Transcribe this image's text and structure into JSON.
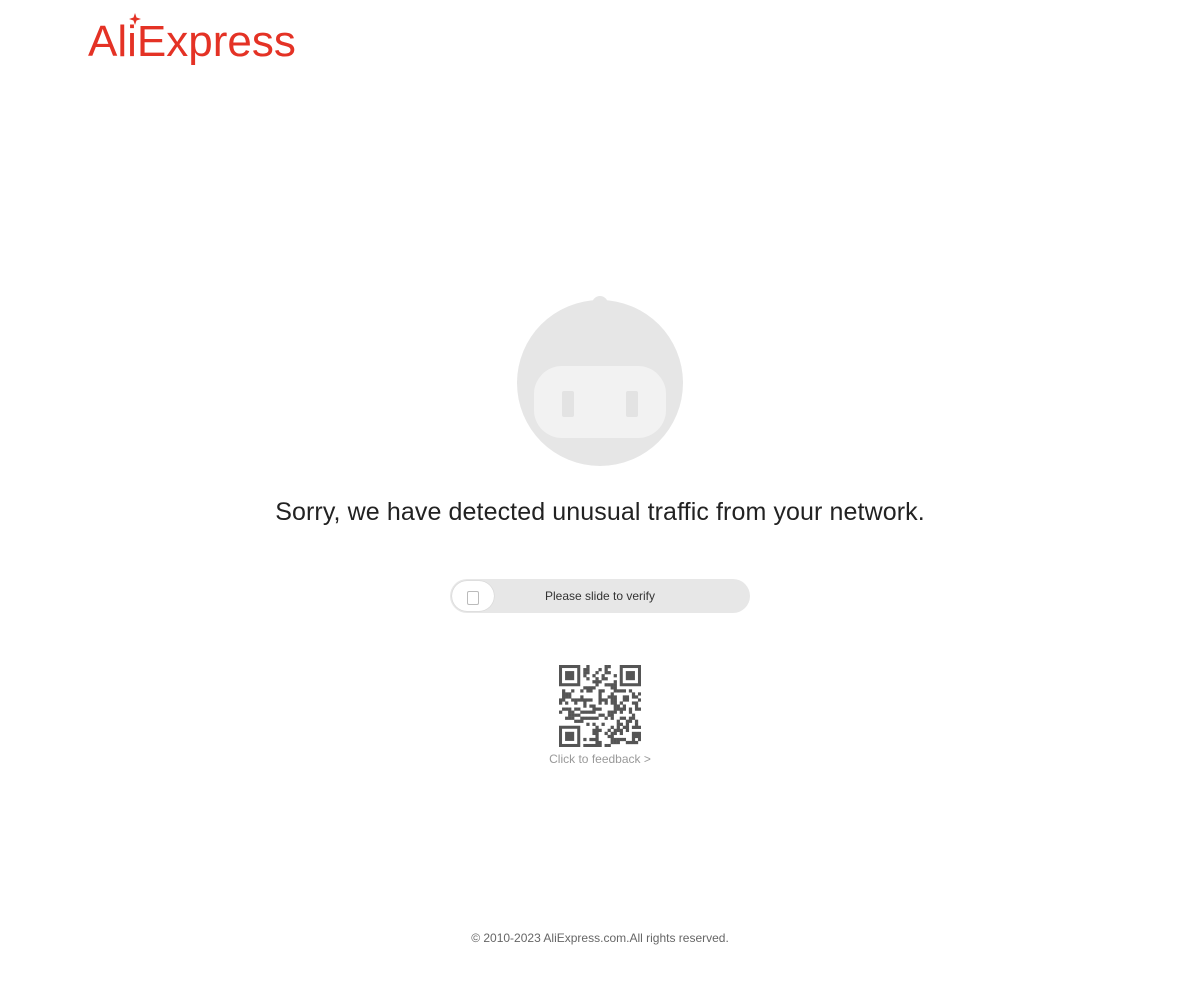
{
  "brand": {
    "logo_text": "AliExpress",
    "logo_color": "#e43225"
  },
  "robot": {
    "icon": "robot-icon",
    "color": "#e6e6e6"
  },
  "message": {
    "headline": "Sorry, we have detected unusual traffic from your network."
  },
  "verify": {
    "slider_label": "Please slide to verify",
    "handle_icon": "lock-icon",
    "progress": 0
  },
  "feedback": {
    "qr_icon": "qr-code-icon",
    "link_label": "Click to feedback >"
  },
  "footer": {
    "copyright": "© 2010-2023 AliExpress.com.All rights reserved."
  }
}
